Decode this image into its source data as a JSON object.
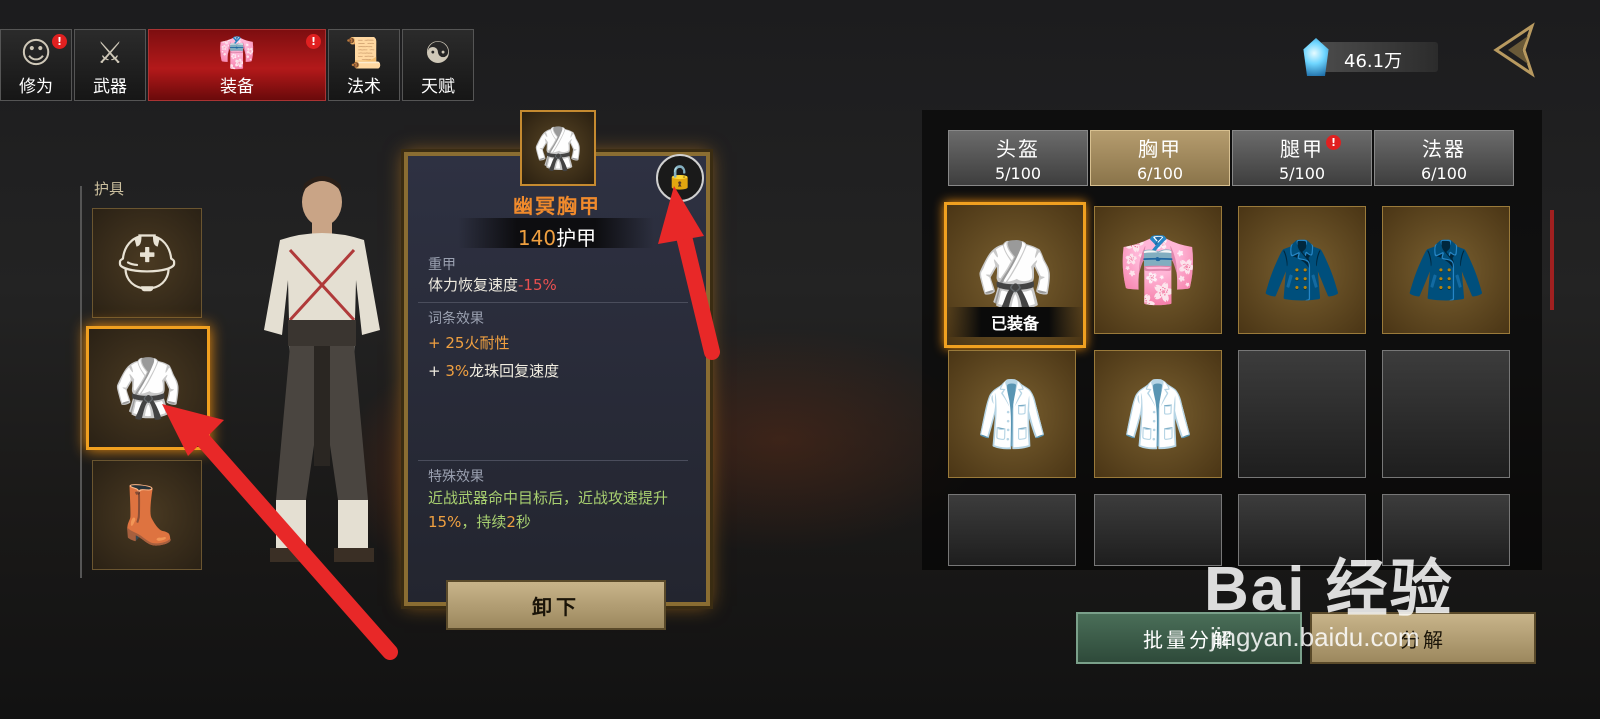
{
  "nav": {
    "tabs": [
      {
        "label": "修为",
        "icon": "person-icon",
        "badge": "!"
      },
      {
        "label": "武器",
        "icon": "sword-icon",
        "badge": ""
      },
      {
        "label": "装备",
        "icon": "robe-icon",
        "badge": "!"
      },
      {
        "label": "法术",
        "icon": "scroll-icon",
        "badge": ""
      },
      {
        "label": "天赋",
        "icon": "yinyang-icon",
        "badge": ""
      }
    ],
    "active_index": 2
  },
  "currency": {
    "amount": "46.1万",
    "icon": "crystal-icon"
  },
  "armor": {
    "title": "护具",
    "slots": [
      {
        "name": "helmet",
        "icon": "helmet-icon"
      },
      {
        "name": "chest",
        "icon": "chest-armor-icon",
        "selected": true
      },
      {
        "name": "boots",
        "icon": "boots-icon"
      }
    ]
  },
  "detail": {
    "item_name": "幽冥胸甲",
    "armor_value": "140",
    "armor_unit": "护甲",
    "type_label": "重甲",
    "stat_label": "体力恢复速度",
    "stat_value": "-15%",
    "affix_title": "词条效果",
    "affix1_prefix": "+ ",
    "affix1_value": "25",
    "affix1_text": "火耐性",
    "affix2_prefix": "+ ",
    "affix2_value": "3%",
    "affix2_text": "龙珠回复速度",
    "special_title": "特殊效果",
    "special_part1": "近战武器命中目标后，近战攻速提升",
    "special_value1": "15%",
    "special_part2": "，持续",
    "special_value2": "2",
    "special_part3": "秒",
    "unequip_label": "卸下",
    "lock_icon": "unlock-icon"
  },
  "inventory": {
    "categories": [
      {
        "name": "头盔",
        "count": "5/100",
        "badge": ""
      },
      {
        "name": "胸甲",
        "count": "6/100",
        "badge": ""
      },
      {
        "name": "腿甲",
        "count": "5/100",
        "badge": "!"
      },
      {
        "name": "法器",
        "count": "6/100",
        "badge": ""
      }
    ],
    "active_category": 1,
    "equipped_label": "已装备",
    "batch_label": "批量分解",
    "decompose_label": "分解"
  },
  "watermark": {
    "main": "Bai 经验",
    "sub": "jingyan.baidu.com"
  },
  "colors": {
    "accent_orange": "#f0a040",
    "selected_border": "#f0a020",
    "active_tab_red": "#b3191a",
    "negative_red": "#e85050",
    "special_green": "#a8d070"
  }
}
